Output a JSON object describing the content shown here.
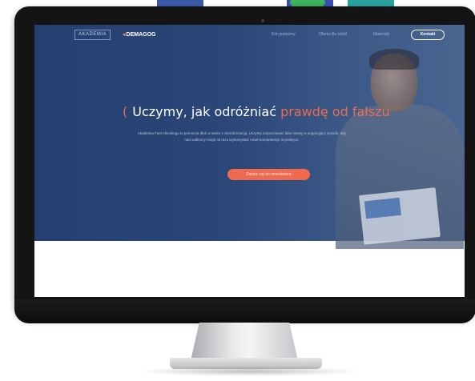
{
  "nav": {
    "logo_primary": "AKADEMIA",
    "logo_secondary": "DEMAGOG",
    "links": [
      "Kim jesteśmy",
      "Oferta dla szkół",
      "Materiały"
    ],
    "contact_label": "Kontakt"
  },
  "hero": {
    "headline_bracket": "(",
    "headline_prefix": "Uczymy, jak odróżniać",
    "headline_accent": "prawdę od fałszu",
    "description": "Akademia Fact-checkingu to pomocna dłoń w walce z dezinformacją. Uczymy rozpoznawać fake newsy w angażujący sposób, aby nasi odbiorcy mogli od razu wykorzystać nowe kompetencje w praktyce.",
    "cta_label": "Zapisz się do newslettera"
  },
  "colors": {
    "hero_bg": "#2a4778",
    "accent": "#ee6b4f",
    "bezel": "#141414"
  }
}
